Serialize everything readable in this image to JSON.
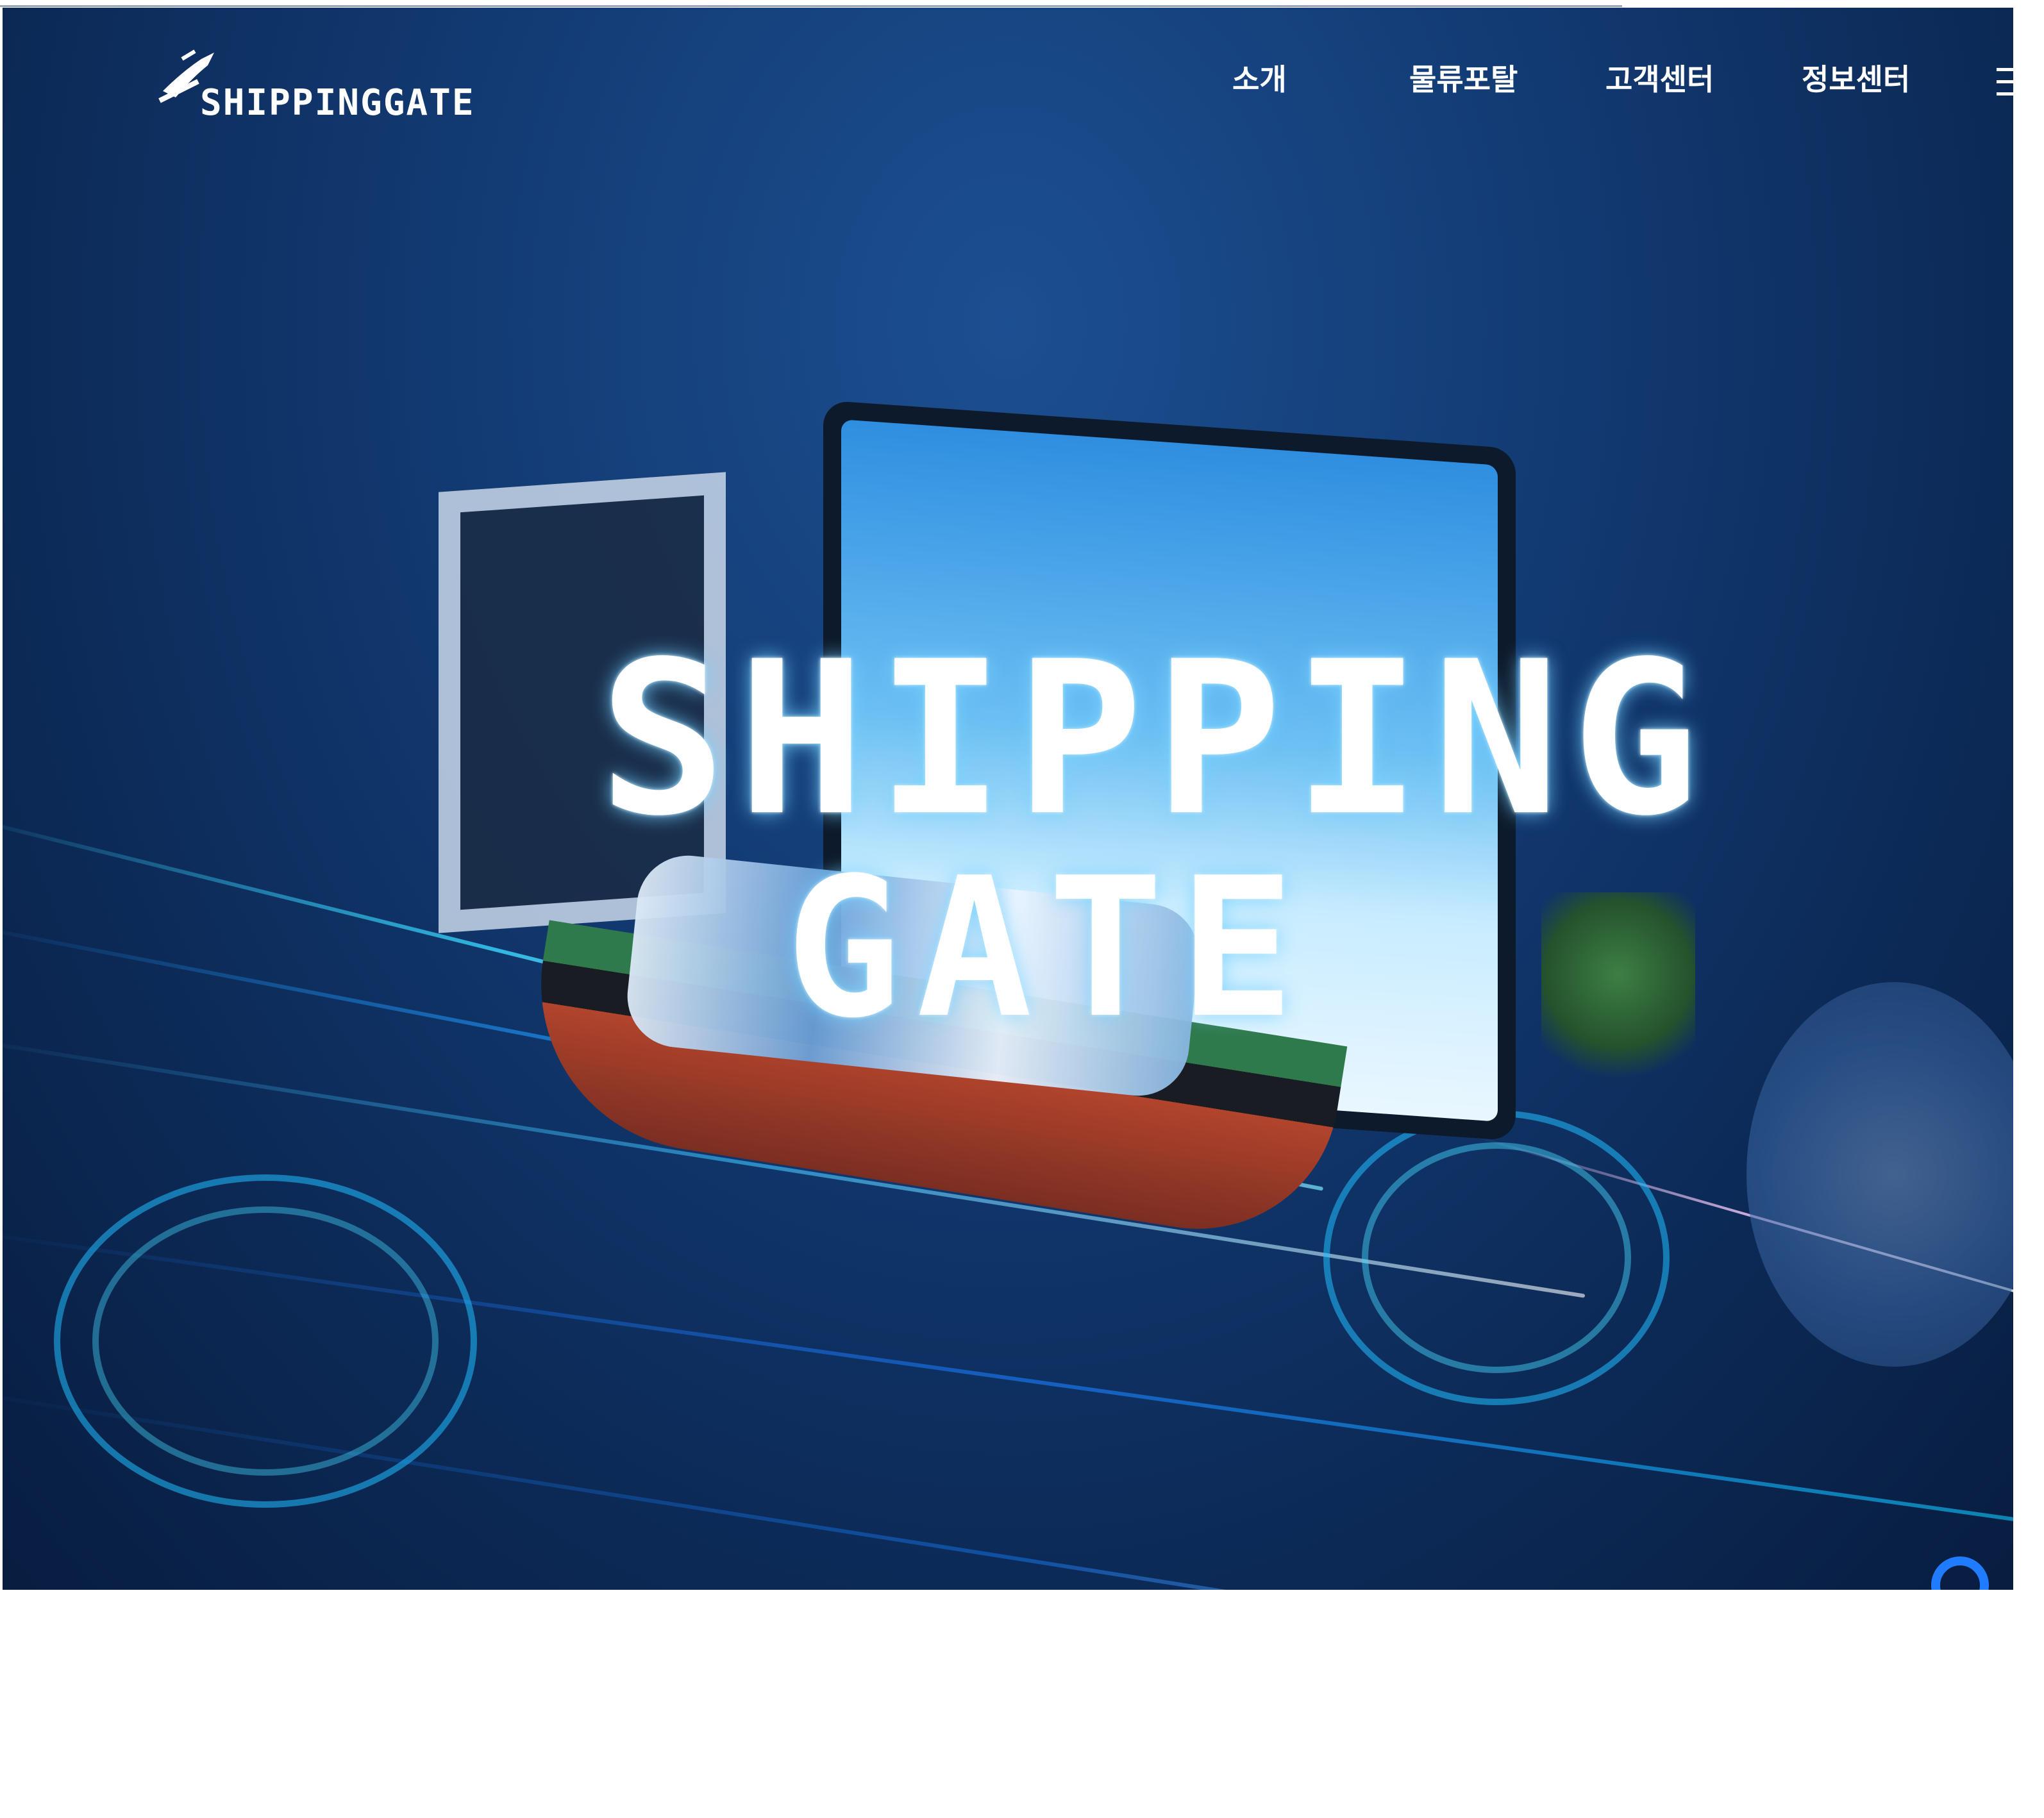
{
  "header": {
    "logo_text": "SHIPPINGGATE",
    "nav": [
      "소개",
      "물류포탈",
      "고객센터",
      "정보센터"
    ]
  },
  "hero": {
    "title_line1": "SHIPPING",
    "title_line2": "GATE"
  },
  "icons": {
    "logo": "ship-gate-logo-icon",
    "menu": "menu-icon",
    "scroll": "scroll-indicator-icon"
  },
  "colors": {
    "hero_bg": "#123a72",
    "accent": "#1f7bff",
    "beam": "#38d7ff",
    "nav_text": "#ffffff"
  }
}
